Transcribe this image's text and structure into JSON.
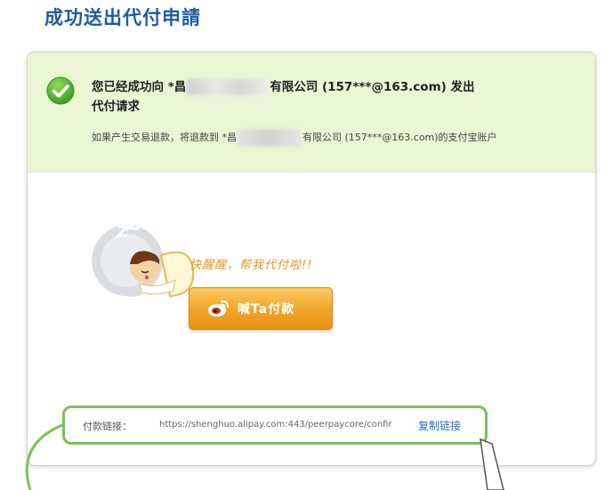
{
  "page": {
    "title": "成功送出代付申請"
  },
  "banner": {
    "line1_before": "您已经成功向 *昌",
    "line1_after": "有限公司 (157***@163.com) 发出",
    "line2": "代付请求",
    "sub_before": "如果产生交易退款，将退款到 *昌",
    "sub_after": "有限公司 (157***@163.com)的支付宝账户"
  },
  "reminder": {
    "wake_text": "快醒醒，帮我代付啦!!",
    "button_label": "喊Ta付款"
  },
  "link": {
    "label": "付款链接：",
    "url": "https://shenghuo.alipay.com:443/peerpaycore/confir",
    "copy_label": "复制链接"
  },
  "colors": {
    "title": "#1f5c9e",
    "success_bg": "#eaf5d4",
    "success_icon": "#5cb83a",
    "button": "#f1a228",
    "wake_text": "#e8961e",
    "highlight_outline": "#7bc258",
    "link": "#2a6bbf"
  },
  "icons": {
    "success": "check-circle-icon",
    "button": "weibo-icon",
    "illustration": "sleeping-character-icon"
  }
}
